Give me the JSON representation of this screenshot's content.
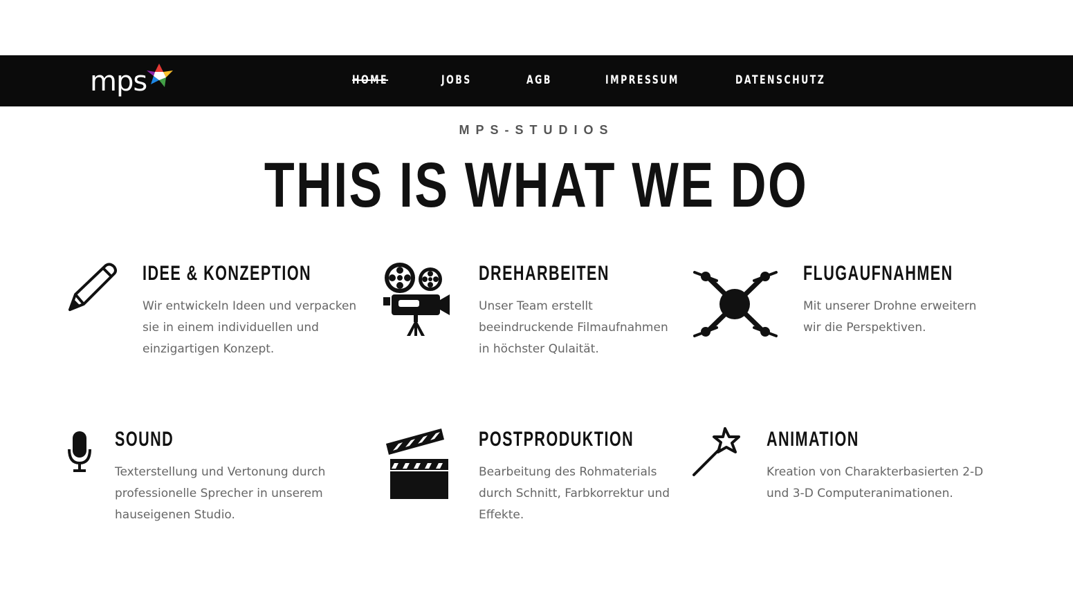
{
  "nav": {
    "logo_text": "mps",
    "items": [
      {
        "label": "HOME",
        "active": true
      },
      {
        "label": "JOBS"
      },
      {
        "label": "AGB"
      },
      {
        "label": "IMPRESSUM"
      },
      {
        "label": "DATENSCHUTZ"
      }
    ]
  },
  "hero": {
    "eyebrow": "MPS-STUDIOS",
    "title": "THIS IS WHAT WE DO"
  },
  "services": [
    {
      "title": "IDEE & KONZEPTION",
      "icon": "pencil-icon",
      "text": "Wir entwickeln Ideen und verpacken sie in einem individuellen und einzigartigen Konzept."
    },
    {
      "title": "DREHARBEITEN",
      "icon": "film-camera-icon",
      "text": "Unser Team erstellt beeindruckende Filmaufnahmen in höchster Qulaität."
    },
    {
      "title": "FLUGAUFNAHMEN",
      "icon": "drone-icon",
      "text": "Mit unserer Drohne erweitern wir die Perspektiven."
    },
    {
      "title": "SOUND",
      "icon": "microphone-icon",
      "text": "Texterstellung und Vertonung durch professionelle Sprecher in unserem hauseigenen Studio."
    },
    {
      "title": "POSTPRODUKTION",
      "icon": "clapperboard-icon",
      "text": "Bearbeitung des Rohmaterials durch Schnitt, Farbkorrektur und Effekte."
    },
    {
      "title": "ANIMATION",
      "icon": "magic-wand-icon",
      "text": "Kreation von Charakterbasierten 2-D und 3-D Computeranimationen."
    }
  ],
  "colors": {
    "nav_bg": "#0b0b0b",
    "heading": "#111111",
    "body_text": "#666666",
    "logo_star": [
      "#e53935",
      "#fbc02d",
      "#43a047",
      "#1e88e5"
    ]
  }
}
